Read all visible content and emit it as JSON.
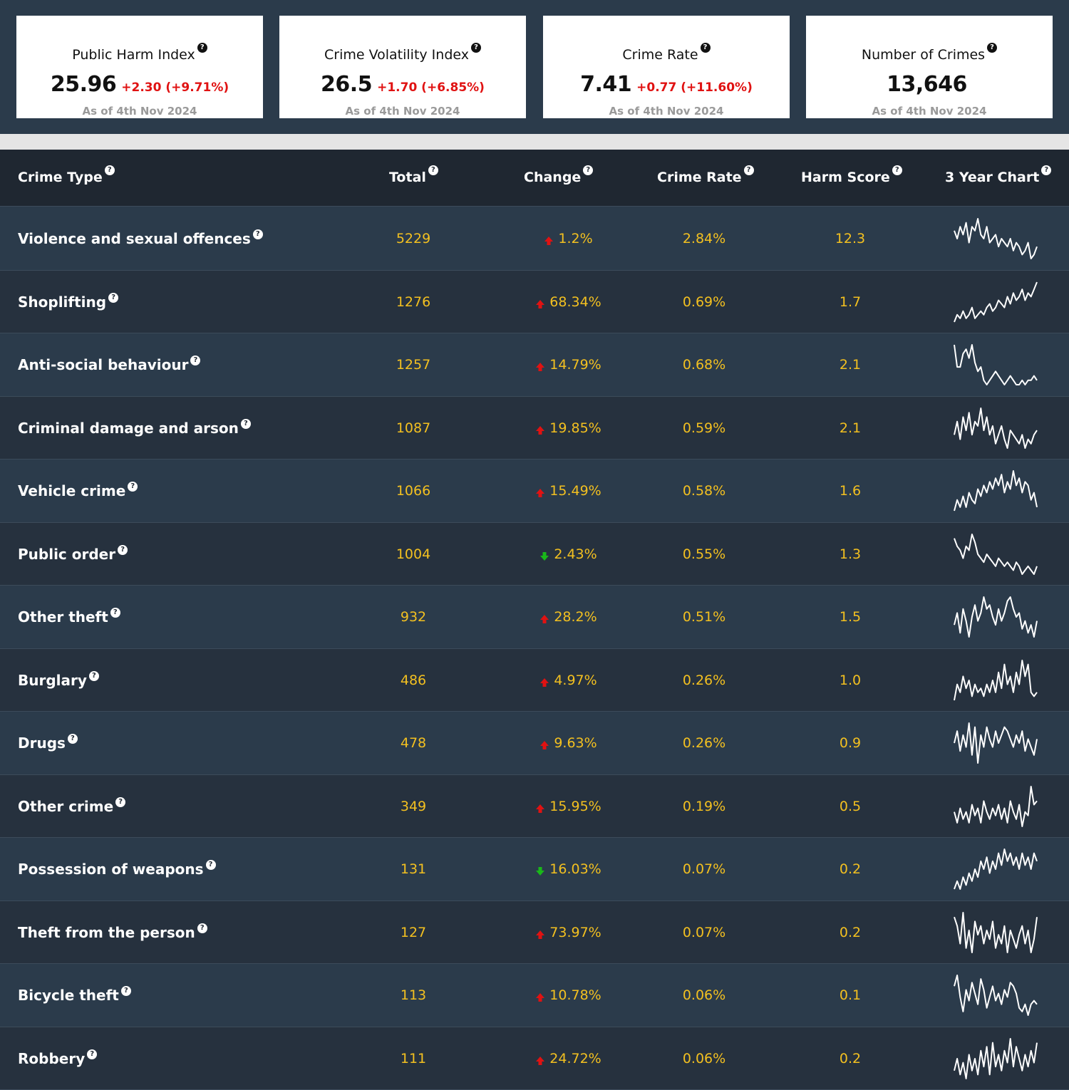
{
  "cards": [
    {
      "title": "Public Harm Index",
      "value": "25.96",
      "delta": "+2.30 (+9.71%)",
      "asof": "As of 4th Nov 2024"
    },
    {
      "title": "Crime Volatility Index",
      "value": "26.5",
      "delta": "+1.70 (+6.85%)",
      "asof": "As of 4th Nov 2024"
    },
    {
      "title": "Crime Rate",
      "value": "7.41",
      "delta": "+0.77 (+11.60%)",
      "asof": "As of 4th Nov 2024"
    },
    {
      "title": "Number of Crimes",
      "value": "13,646",
      "delta": "",
      "asof": "As of 4th Nov 2024"
    }
  ],
  "help_glyph": "?",
  "table": {
    "headers": {
      "crime_type": "Crime Type",
      "total": "Total",
      "change": "Change",
      "crime_rate": "Crime Rate",
      "harm_score": "Harm Score",
      "chart": "3 Year Chart"
    },
    "rows": [
      {
        "type": "Violence and sexual offences",
        "total": "5229",
        "direction": "up",
        "change": "1.2%",
        "rate": "2.84%",
        "harm": "12.3",
        "trend": [
          8,
          6,
          9,
          7,
          10,
          5,
          9,
          8,
          11,
          7,
          6,
          9,
          5,
          6,
          7,
          4,
          6,
          5,
          4,
          6,
          3,
          5,
          4,
          2,
          3,
          5,
          1,
          2,
          4
        ]
      },
      {
        "type": "Shoplifting",
        "total": "1276",
        "direction": "up",
        "change": "68.34%",
        "rate": "0.69%",
        "harm": "1.7",
        "trend": [
          1,
          3,
          2,
          4,
          2,
          3,
          5,
          2,
          3,
          4,
          3,
          5,
          6,
          4,
          5,
          7,
          6,
          5,
          8,
          6,
          9,
          7,
          8,
          10,
          7,
          9,
          8,
          10,
          12
        ]
      },
      {
        "type": "Anti-social behaviour",
        "total": "1257",
        "direction": "up",
        "change": "14.79%",
        "rate": "0.68%",
        "harm": "2.1",
        "trend": [
          11,
          6,
          6,
          9,
          10,
          8,
          11,
          7,
          5,
          6,
          3,
          2,
          3,
          4,
          5,
          4,
          3,
          2,
          3,
          4,
          3,
          2,
          2,
          3,
          2,
          3,
          3,
          4,
          3
        ]
      },
      {
        "type": "Criminal damage and arson",
        "total": "1087",
        "direction": "up",
        "change": "19.85%",
        "rate": "0.59%",
        "harm": "2.1",
        "trend": [
          6,
          9,
          5,
          10,
          7,
          11,
          6,
          9,
          8,
          12,
          7,
          10,
          6,
          8,
          4,
          6,
          8,
          5,
          3,
          7,
          6,
          5,
          4,
          6,
          3,
          5,
          4,
          6,
          7
        ]
      },
      {
        "type": "Vehicle crime",
        "total": "1066",
        "direction": "up",
        "change": "15.49%",
        "rate": "0.58%",
        "harm": "1.6",
        "trend": [
          1,
          4,
          2,
          5,
          2,
          6,
          4,
          3,
          7,
          5,
          8,
          6,
          9,
          7,
          10,
          8,
          11,
          6,
          9,
          7,
          12,
          8,
          10,
          6,
          9,
          8,
          4,
          6,
          2
        ]
      },
      {
        "type": "Public order",
        "total": "1004",
        "direction": "down",
        "change": "2.43%",
        "rate": "0.55%",
        "harm": "1.3",
        "trend": [
          10,
          8,
          7,
          5,
          8,
          7,
          11,
          9,
          6,
          5,
          4,
          6,
          5,
          4,
          3,
          5,
          4,
          3,
          4,
          3,
          2,
          4,
          3,
          1,
          2,
          3,
          2,
          1,
          3
        ]
      },
      {
        "type": "Other theft",
        "total": "932",
        "direction": "up",
        "change": "28.2%",
        "rate": "0.51%",
        "harm": "1.5",
        "trend": [
          5,
          8,
          3,
          9,
          6,
          2,
          7,
          10,
          6,
          8,
          12,
          9,
          10,
          7,
          5,
          9,
          6,
          8,
          11,
          12,
          9,
          7,
          8,
          4,
          6,
          3,
          5,
          2,
          6
        ]
      },
      {
        "type": "Burglary",
        "total": "486",
        "direction": "up",
        "change": "4.97%",
        "rate": "0.26%",
        "harm": "1.0",
        "trend": [
          2,
          6,
          4,
          8,
          5,
          7,
          3,
          6,
          4,
          5,
          3,
          6,
          4,
          7,
          4,
          9,
          5,
          11,
          6,
          8,
          4,
          9,
          6,
          12,
          8,
          11,
          4,
          3,
          4
        ]
      },
      {
        "type": "Drugs",
        "total": "478",
        "direction": "up",
        "change": "9.63%",
        "rate": "0.26%",
        "harm": "0.9",
        "trend": [
          6,
          9,
          4,
          8,
          5,
          11,
          3,
          10,
          1,
          8,
          5,
          10,
          7,
          5,
          9,
          6,
          8,
          10,
          9,
          7,
          5,
          8,
          6,
          9,
          4,
          7,
          5,
          3,
          7
        ]
      },
      {
        "type": "Other crime",
        "total": "349",
        "direction": "up",
        "change": "15.95%",
        "rate": "0.19%",
        "harm": "0.5",
        "trend": [
          5,
          2,
          6,
          3,
          5,
          2,
          7,
          4,
          6,
          2,
          8,
          5,
          3,
          6,
          4,
          7,
          3,
          6,
          2,
          8,
          5,
          3,
          7,
          1,
          5,
          4,
          12,
          7,
          8
        ]
      },
      {
        "type": "Possession of weapons",
        "total": "131",
        "direction": "down",
        "change": "16.03%",
        "rate": "0.07%",
        "harm": "0.2",
        "trend": [
          1,
          3,
          1,
          4,
          2,
          5,
          3,
          6,
          4,
          8,
          6,
          9,
          5,
          8,
          6,
          10,
          7,
          11,
          8,
          10,
          7,
          9,
          6,
          10,
          7,
          9,
          6,
          10,
          8
        ]
      },
      {
        "type": "Theft from the person",
        "total": "127",
        "direction": "up",
        "change": "73.97%",
        "rate": "0.07%",
        "harm": "0.2",
        "trend": [
          11,
          9,
          5,
          12,
          4,
          8,
          3,
          10,
          7,
          9,
          5,
          8,
          6,
          10,
          4,
          7,
          5,
          9,
          3,
          8,
          6,
          4,
          7,
          9,
          5,
          8,
          3,
          6,
          11
        ]
      },
      {
        "type": "Bicycle theft",
        "total": "113",
        "direction": "up",
        "change": "10.78%",
        "rate": "0.06%",
        "harm": "0.1",
        "trend": [
          9,
          12,
          6,
          2,
          8,
          5,
          10,
          7,
          4,
          11,
          8,
          3,
          6,
          9,
          5,
          7,
          4,
          8,
          6,
          10,
          9,
          7,
          3,
          2,
          4,
          1,
          4,
          5,
          4
        ]
      },
      {
        "type": "Robbery",
        "total": "111",
        "direction": "up",
        "change": "24.72%",
        "rate": "0.06%",
        "harm": "0.2",
        "trend": [
          3,
          6,
          2,
          5,
          1,
          7,
          3,
          6,
          2,
          8,
          4,
          9,
          2,
          10,
          4,
          7,
          3,
          8,
          5,
          11,
          4,
          9,
          6,
          3,
          7,
          4,
          8,
          5,
          10
        ]
      }
    ]
  },
  "colors": {
    "up_arrow": "#e01212",
    "down_arrow": "#19b819",
    "value_text": "#f3c020",
    "row_odd": "#2b3b4b",
    "row_even": "#26313e",
    "header_bg": "#1f2731",
    "separator_bg": "#e5e5e5"
  },
  "icons": {
    "help": "question-circle-icon",
    "up": "arrow-up-icon",
    "down": "arrow-down-icon"
  }
}
